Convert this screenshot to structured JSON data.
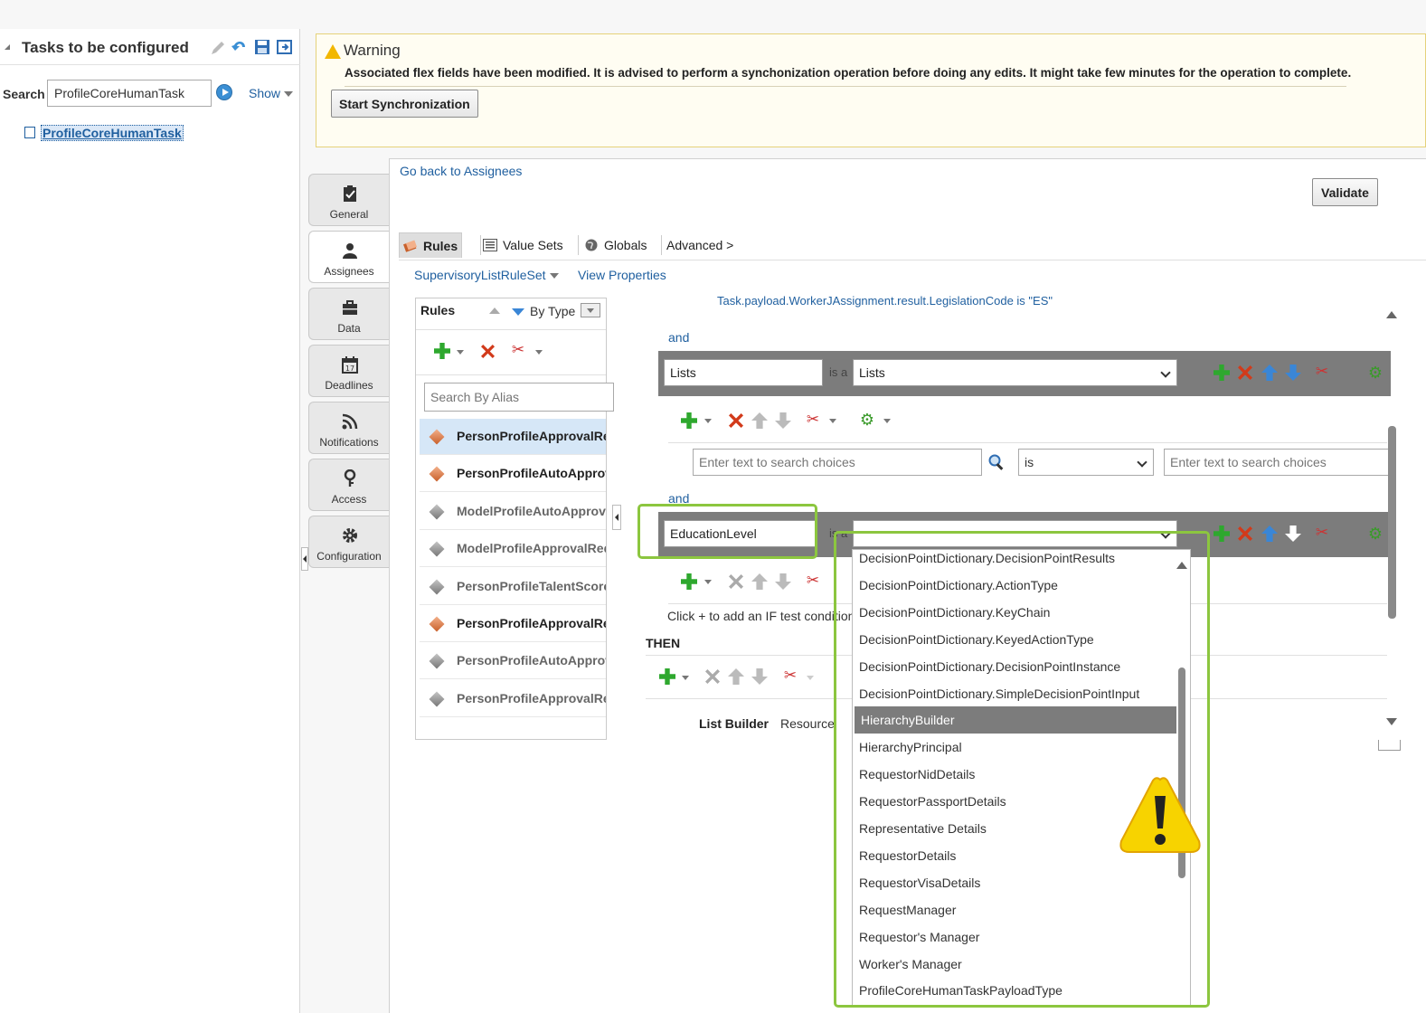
{
  "left_panel": {
    "title": "Tasks to be configured",
    "search_label": "Search",
    "search_value": "ProfileCoreHumanTask",
    "show_label": "Show",
    "task_item": "ProfileCoreHumanTask"
  },
  "warning": {
    "title": "Warning",
    "message": "Associated flex fields have been modified. It is advised to perform a synchonization operation before doing any edits. It might take few minutes for the operation to complete.",
    "button": "Start Synchronization"
  },
  "vertical_tabs": [
    {
      "label": "General",
      "icon": "clipboard-check-icon"
    },
    {
      "label": "Assignees",
      "icon": "user-icon",
      "active": true
    },
    {
      "label": "Data",
      "icon": "briefcase-icon"
    },
    {
      "label": "Deadlines",
      "icon": "calendar-icon"
    },
    {
      "label": "Notifications",
      "icon": "rss-icon"
    },
    {
      "label": "Access",
      "icon": "keys-icon"
    },
    {
      "label": "Configuration",
      "icon": "gear-icon"
    }
  ],
  "main": {
    "go_back": "Go back to Assignees",
    "validate": "Validate",
    "subtabs": [
      {
        "label": "Rules",
        "icon": "rules-icon",
        "active": true
      },
      {
        "label": "Value Sets",
        "icon": "list-icon"
      },
      {
        "label": "Globals",
        "icon": "globe-icon"
      },
      {
        "label": "Advanced >",
        "icon": ""
      }
    ],
    "ruleset": "SupervisoryListRuleSet",
    "view_properties": "View Properties"
  },
  "rules_panel": {
    "title": "Rules",
    "sort_label": "By Type",
    "search_placeholder": "Search By Alias",
    "rules": [
      {
        "name": "PersonProfileApprovalRe",
        "color": "orange",
        "selected": true,
        "dim": false
      },
      {
        "name": "PersonProfileAutoApprov",
        "color": "orange",
        "selected": false,
        "dim": false
      },
      {
        "name": "ModelProfileAutoApprova",
        "color": "gray",
        "selected": false,
        "dim": true
      },
      {
        "name": "ModelProfileApprovalReq",
        "color": "gray",
        "selected": false,
        "dim": true
      },
      {
        "name": "PersonProfileTalentScore",
        "color": "gray",
        "selected": false,
        "dim": true
      },
      {
        "name": "PersonProfileApprovalRe",
        "color": "orange",
        "selected": false,
        "dim": false
      },
      {
        "name": "PersonProfileAutoApprov",
        "color": "gray",
        "selected": false,
        "dim": true
      },
      {
        "name": "PersonProfileApprovalRe",
        "color": "gray",
        "selected": false,
        "dim": true
      }
    ]
  },
  "editor": {
    "truncated_text": "Task.payload.WorkerJAssignment.result.LegislationCode is \"ES\"",
    "and_label": "and",
    "cond1_field": "Lists",
    "is_a": "is a",
    "cond1_select": "Lists",
    "search_placeholder": "Enter text to search choices",
    "operator": "is",
    "cond2_field": "EducationLevel",
    "is_a_partial": "is a",
    "click_hint": "Click + to add an IF test condition",
    "then": "THEN",
    "list_builder": "List Builder",
    "resource": "Resource"
  },
  "dropdown": {
    "items": [
      "DecisionPointDictionary.DecisionPointResults",
      "DecisionPointDictionary.ActionType",
      "DecisionPointDictionary.KeyChain",
      "DecisionPointDictionary.KeyedActionType",
      "DecisionPointDictionary.DecisionPointInstance",
      "DecisionPointDictionary.SimpleDecisionPointInput",
      "HierarchyBuilder",
      "HierarchyPrincipal",
      "RequestorNidDetails",
      "RequestorPassportDetails",
      "Representative Details",
      "RequestorDetails",
      "RequestorVisaDetails",
      "RequestManager",
      "Requestor's Manager",
      "Worker's Manager",
      "ProfileCoreHumanTaskPayloadType"
    ],
    "selected": "HierarchyBuilder"
  },
  "colors": {
    "highlight_outline": "#8cc63f",
    "warning_yellow": "#f2b700",
    "link": "#1f5f9f"
  }
}
